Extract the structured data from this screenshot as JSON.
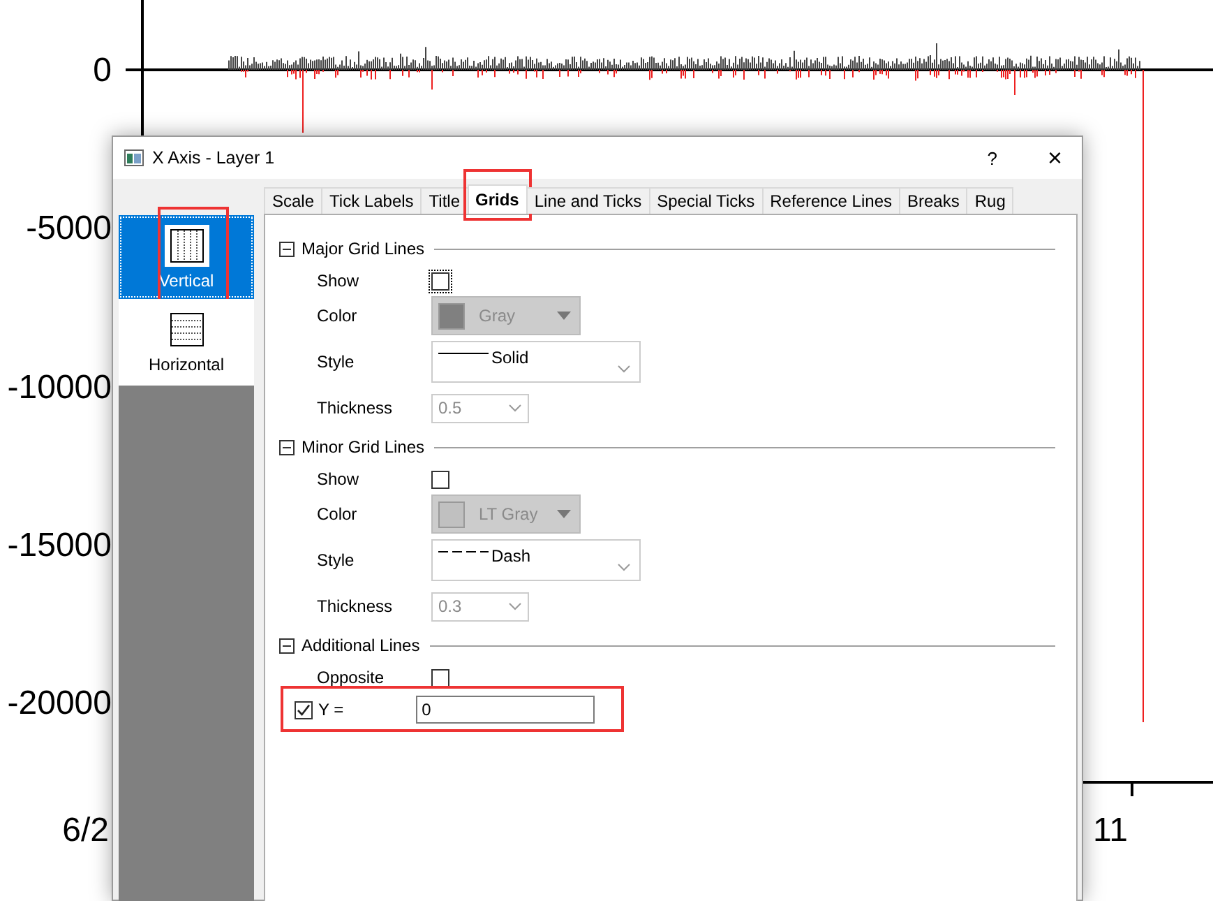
{
  "plot": {
    "y_ticks": [
      "0",
      "-5000",
      "-10000",
      "-15000",
      "-20000"
    ],
    "x_ticks": [
      "6/2",
      "11"
    ]
  },
  "dialog": {
    "title": "X Axis - Layer 1",
    "help": "?",
    "close": "×",
    "side_items": [
      {
        "label": "Vertical",
        "kind": "vertical",
        "selected": true,
        "highlighted": true
      },
      {
        "label": "Horizontal",
        "kind": "horizontal",
        "selected": false,
        "highlighted": false
      }
    ],
    "tabs": [
      {
        "label": "Scale",
        "selected": false,
        "highlighted": false
      },
      {
        "label": "Tick Labels",
        "selected": false,
        "highlighted": false
      },
      {
        "label": "Title",
        "selected": false,
        "highlighted": false
      },
      {
        "label": "Grids",
        "selected": true,
        "highlighted": true
      },
      {
        "label": "Line and Ticks",
        "selected": false,
        "highlighted": false
      },
      {
        "label": "Special Ticks",
        "selected": false,
        "highlighted": false
      },
      {
        "label": "Reference Lines",
        "selected": false,
        "highlighted": false
      },
      {
        "label": "Breaks",
        "selected": false,
        "highlighted": false
      },
      {
        "label": "Rug",
        "selected": false,
        "highlighted": false
      }
    ],
    "groups": [
      {
        "title": "Major Grid Lines",
        "expanded": true,
        "rows": [
          {
            "kind": "checkbox",
            "label": "Show",
            "checked": false,
            "focused": true
          },
          {
            "kind": "color",
            "label": "Color",
            "value": "Gray",
            "color": "#808080",
            "disabled": true
          },
          {
            "kind": "solidline",
            "label": "Style",
            "value": "Solid"
          },
          {
            "kind": "dropdown",
            "label": "Thickness",
            "value": "0.5",
            "disabled": true
          }
        ]
      },
      {
        "title": "Minor Grid Lines",
        "expanded": true,
        "rows": [
          {
            "kind": "checkbox",
            "label": "Show",
            "checked": false,
            "focused": false
          },
          {
            "kind": "color",
            "label": "Color",
            "value": "LT Gray",
            "color": "#c0c0c0",
            "disabled": true
          },
          {
            "kind": "dashline",
            "label": "Style",
            "value": "Dash"
          },
          {
            "kind": "dropdown",
            "label": "Thickness",
            "value": "0.3",
            "disabled": true
          }
        ]
      },
      {
        "title": "Additional Lines",
        "expanded": true,
        "rows": [
          {
            "kind": "checkbox",
            "label": "Opposite",
            "checked": false,
            "focused": false
          },
          {
            "kind": "checked-input",
            "label": "Y =",
            "checked": true,
            "value": "0",
            "highlighted": true
          }
        ]
      }
    ]
  }
}
